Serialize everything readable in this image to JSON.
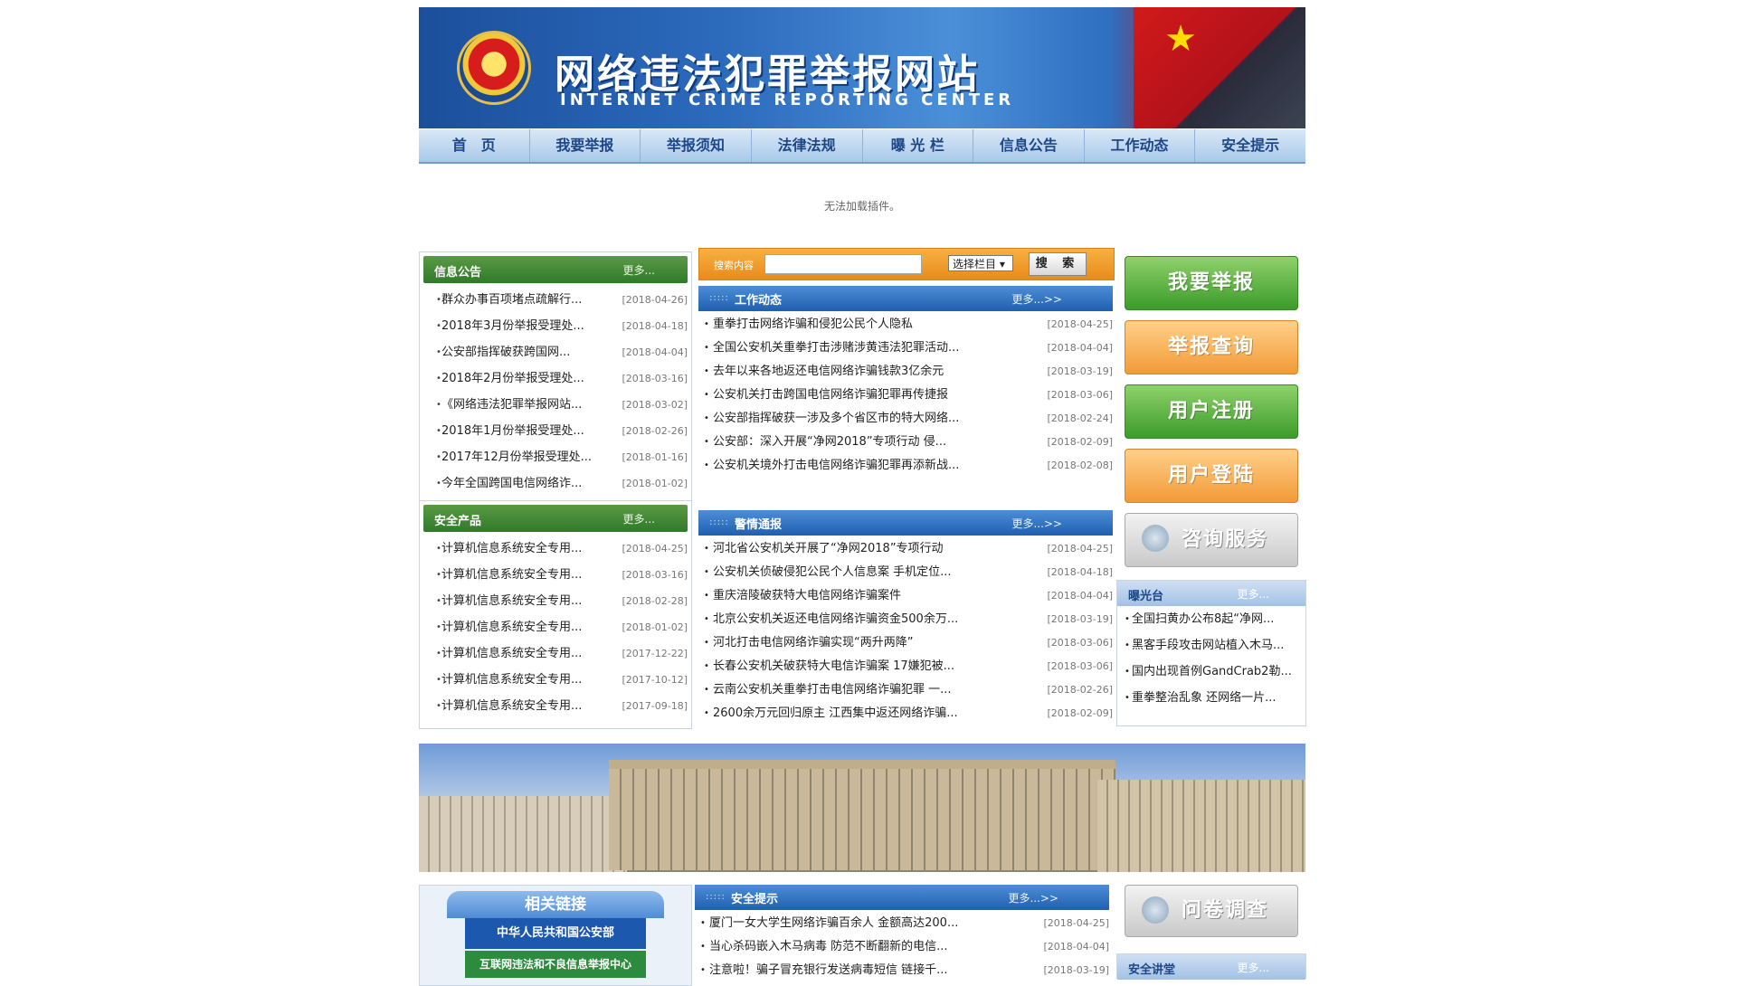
{
  "header": {
    "title_cn": "网络违法犯罪举报网站",
    "title_en": "INTERNET CRIME REPORTING CENTER"
  },
  "nav": [
    "首　页",
    "我要举报",
    "举报须知",
    "法律法规",
    "曝 光 栏",
    "信息公告",
    "工作动态",
    "安全提示"
  ],
  "plugin_message": "无法加载插件。",
  "search": {
    "label": "搜索内容",
    "select": "选择栏目 ▾",
    "button": "搜 索"
  },
  "info": {
    "title": "信息公告",
    "more": "更多...",
    "items": [
      {
        "text": "群众办事百项堵点疏解行...",
        "date": "[2018-04-26]"
      },
      {
        "text": "2018年3月份举报受理处...",
        "date": "[2018-04-18]"
      },
      {
        "text": "公安部指挥破获跨国网...",
        "date": "[2018-04-04]"
      },
      {
        "text": "2018年2月份举报受理处...",
        "date": "[2018-03-16]"
      },
      {
        "text": "《网络违法犯罪举报网站...",
        "date": "[2018-03-02]"
      },
      {
        "text": "2018年1月份举报受理处...",
        "date": "[2018-02-26]"
      },
      {
        "text": "2017年12月份举报受理处...",
        "date": "[2018-01-16]"
      },
      {
        "text": "今年全国跨国电信网络诈...",
        "date": "[2018-01-02]"
      }
    ]
  },
  "products": {
    "title": "安全产品",
    "more": "更多...",
    "items": [
      {
        "text": "计算机信息系统安全专用...",
        "date": "[2018-04-25]"
      },
      {
        "text": "计算机信息系统安全专用...",
        "date": "[2018-03-16]"
      },
      {
        "text": "计算机信息系统安全专用...",
        "date": "[2018-02-28]"
      },
      {
        "text": "计算机信息系统安全专用...",
        "date": "[2018-01-02]"
      },
      {
        "text": "计算机信息系统安全专用...",
        "date": "[2017-12-22]"
      },
      {
        "text": "计算机信息系统安全专用...",
        "date": "[2017-10-12]"
      },
      {
        "text": "计算机信息系统安全专用...",
        "date": "[2017-09-18]"
      }
    ]
  },
  "work": {
    "title": "工作动态",
    "more": "更多...>>",
    "items": [
      {
        "text": "重拳打击网络诈骗和侵犯公民个人隐私",
        "date": "[2018-04-25]"
      },
      {
        "text": "全国公安机关重拳打击涉赌涉黄违法犯罪活动...",
        "date": "[2018-04-04]"
      },
      {
        "text": "去年以来各地返还电信网络诈骗钱款3亿余元",
        "date": "[2018-03-19]"
      },
      {
        "text": "公安机关打击跨国电信网络诈骗犯罪再传捷报",
        "date": "[2018-03-06]"
      },
      {
        "text": "公安部指挥破获一涉及多个省区市的特大网络...",
        "date": "[2018-02-24]"
      },
      {
        "text": "公安部：深入开展“净网2018”专项行动 侵...",
        "date": "[2018-02-09]"
      },
      {
        "text": "公安机关境外打击电信网络诈骗犯罪再添新战...",
        "date": "[2018-02-08]"
      }
    ]
  },
  "alerts": {
    "title": "警情通报",
    "more": "更多...>>",
    "items": [
      {
        "text": "河北省公安机关开展了“净网2018”专项行动",
        "date": "[2018-04-25]"
      },
      {
        "text": "公安机关侦破侵犯公民个人信息案 手机定位...",
        "date": "[2018-04-18]"
      },
      {
        "text": "重庆涪陵破获特大电信网络诈骗案件",
        "date": "[2018-04-04]"
      },
      {
        "text": "北京公安机关返还电信网络诈骗资金500余万...",
        "date": "[2018-03-19]"
      },
      {
        "text": "河北打击电信网络诈骗实现“两升两降”",
        "date": "[2018-03-06]"
      },
      {
        "text": "长春公安机关破获特大电信诈骗案 17嫌犯被...",
        "date": "[2018-03-06]"
      },
      {
        "text": "云南公安机关重拳打击电信网络诈骗犯罪 一...",
        "date": "[2018-02-26]"
      },
      {
        "text": "2600余万元回归原主 江西集中返还网络诈骗...",
        "date": "[2018-02-09]"
      }
    ]
  },
  "tips": {
    "title": "安全提示",
    "more": "更多...>>",
    "items": [
      {
        "text": "厦门一女大学生网络诈骗百余人 金额高达200...",
        "date": "[2018-04-25]"
      },
      {
        "text": "当心杀码嵌入木马病毒 防范不断翻新的电信...",
        "date": "[2018-04-04]"
      },
      {
        "text": "注意啦！骗子冒充银行发送病毒短信 链接千...",
        "date": "[2018-03-19]"
      }
    ]
  },
  "right_buttons": {
    "report": "我要举报",
    "query": "举报查询",
    "register": "用户注册",
    "login": "用户登陆",
    "consult": "咨询服务",
    "survey": "问卷调查"
  },
  "exposure": {
    "title": "曝光台",
    "more": "更多...",
    "items": [
      "全国扫黄办公布8起“净网...",
      "黑客手段攻击网站植入木马...",
      "国内出现首例GandCrab2勒...",
      "重拳整治乱象 还网络一片..."
    ]
  },
  "lecture": {
    "title": "安全讲堂",
    "more": "更多..."
  },
  "links": {
    "title": "相关链接",
    "logo1": "中华人民共和国公安部",
    "logo2": "互联网违法和不良信息举报中心"
  }
}
